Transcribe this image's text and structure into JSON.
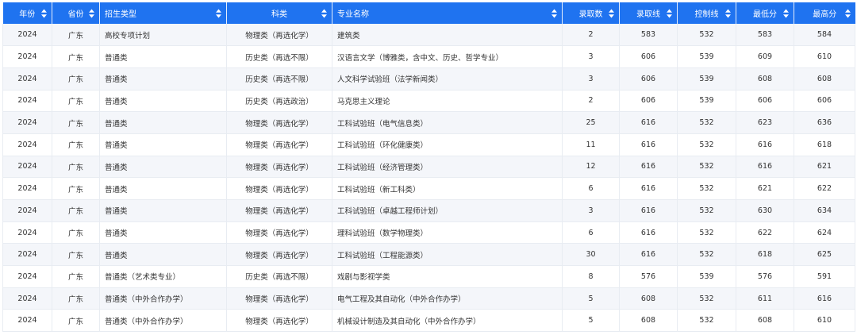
{
  "table": {
    "columns": [
      {
        "label": "年份",
        "align": "center",
        "width": 62
      },
      {
        "label": "省份",
        "align": "center",
        "width": 60
      },
      {
        "label": "招生类型",
        "align": "left",
        "width": 160
      },
      {
        "label": "科类",
        "align": "center",
        "width": 133
      },
      {
        "label": "专业名称",
        "align": "left",
        "width": 290
      },
      {
        "label": "录取数",
        "align": "center",
        "width": 72
      },
      {
        "label": "录取线",
        "align": "center",
        "width": 73
      },
      {
        "label": "控制线",
        "align": "center",
        "width": 74
      },
      {
        "label": "最低分",
        "align": "center",
        "width": 73
      },
      {
        "label": "最高分",
        "align": "center",
        "width": 77
      }
    ],
    "rows": [
      [
        "2024",
        "广东",
        "高校专项计划",
        "物理类（再选化学）",
        "建筑类",
        "2",
        "583",
        "532",
        "583",
        "584"
      ],
      [
        "2024",
        "广东",
        "普通类",
        "历史类（再选不限）",
        "汉语言文学（博雅类，含中文、历史、哲学专业）",
        "3",
        "606",
        "539",
        "609",
        "610"
      ],
      [
        "2024",
        "广东",
        "普通类",
        "历史类（再选不限）",
        "人文科学试验班（法学新闻类）",
        "3",
        "606",
        "539",
        "608",
        "608"
      ],
      [
        "2024",
        "广东",
        "普通类",
        "历史类（再选政治）",
        "马克思主义理论",
        "2",
        "606",
        "539",
        "606",
        "606"
      ],
      [
        "2024",
        "广东",
        "普通类",
        "物理类（再选化学）",
        "工科试验班（电气信息类）",
        "25",
        "616",
        "532",
        "623",
        "636"
      ],
      [
        "2024",
        "广东",
        "普通类",
        "物理类（再选化学）",
        "工科试验班（环化健康类）",
        "11",
        "616",
        "532",
        "616",
        "618"
      ],
      [
        "2024",
        "广东",
        "普通类",
        "物理类（再选化学）",
        "工科试验班（经济管理类）",
        "12",
        "616",
        "532",
        "616",
        "621"
      ],
      [
        "2024",
        "广东",
        "普通类",
        "物理类（再选化学）",
        "工科试验班（新工科类）",
        "6",
        "616",
        "532",
        "621",
        "622"
      ],
      [
        "2024",
        "广东",
        "普通类",
        "物理类（再选化学）",
        "工科试验班（卓越工程师计划）",
        "3",
        "616",
        "532",
        "630",
        "634"
      ],
      [
        "2024",
        "广东",
        "普通类",
        "物理类（再选化学）",
        "理科试验班（数学物理类）",
        "6",
        "616",
        "532",
        "622",
        "624"
      ],
      [
        "2024",
        "广东",
        "普通类",
        "物理类（再选化学）",
        "工科试验班（工程能源类）",
        "30",
        "616",
        "532",
        "618",
        "625"
      ],
      [
        "2024",
        "广东",
        "普通类（艺术类专业）",
        "历史类（再选不限）",
        "戏剧与影视学类",
        "8",
        "576",
        "539",
        "576",
        "591"
      ],
      [
        "2024",
        "广东",
        "普通类（中外合作办学）",
        "物理类（再选化学）",
        "电气工程及其自动化（中外合作办学）",
        "5",
        "608",
        "532",
        "611",
        "616"
      ],
      [
        "2024",
        "广东",
        "普通类（中外合作办学）",
        "物理类（再选化学）",
        "机械设计制造及其自动化（中外合作办学）",
        "5",
        "608",
        "532",
        "608",
        "610"
      ]
    ]
  },
  "colors": {
    "header_bg": "#1f73f0",
    "header_text": "#ffffff",
    "row_alt_bg": "#f4f6fa",
    "row_bg": "#ffffff",
    "cell_text": "#333333"
  },
  "icons": {
    "sort": "sort-icon"
  }
}
